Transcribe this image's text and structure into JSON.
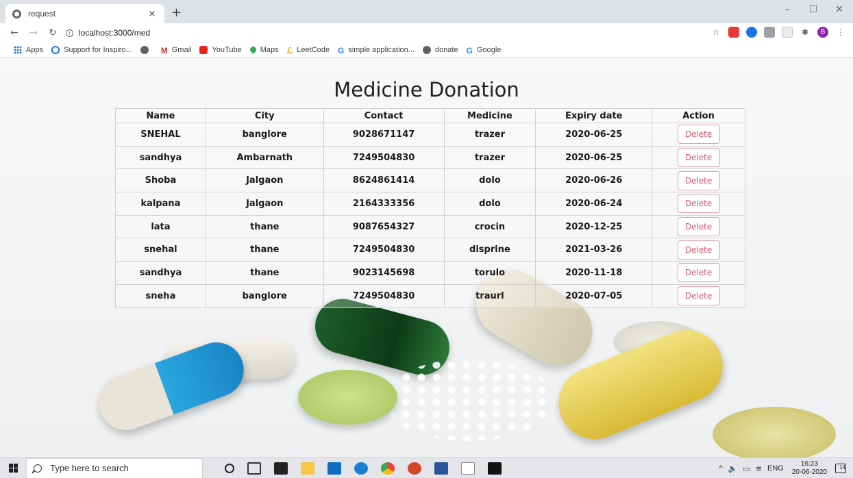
{
  "browser": {
    "tab_title": "request",
    "tab_close": "×",
    "new_tab": "+",
    "url": "localhost:3000/med",
    "window_controls": [
      "–",
      "☐",
      "✕"
    ],
    "bookmarks": [
      {
        "label": "Apps",
        "icon": "apps-icon"
      },
      {
        "label": "Support for Inspiro...",
        "icon": "support-icon"
      },
      {
        "label": "",
        "icon": "globe-icon"
      },
      {
        "label": "Gmail",
        "icon": "gmail-icon"
      },
      {
        "label": "YouTube",
        "icon": "youtube-icon"
      },
      {
        "label": "Maps",
        "icon": "maps-icon"
      },
      {
        "label": "LeetCode",
        "icon": "leetcode-icon"
      },
      {
        "label": "simple application...",
        "icon": "google-icon"
      },
      {
        "label": "donate",
        "icon": "globe-icon"
      },
      {
        "label": "Google",
        "icon": "google-icon"
      }
    ],
    "profile_initial": "B"
  },
  "page": {
    "title": "Medicine Donation",
    "table": {
      "headers": [
        "Name",
        "City",
        "Contact",
        "Medicine",
        "Expiry date",
        "Action"
      ],
      "rows": [
        {
          "name": "SNEHAL",
          "city": "banglore",
          "contact": "9028671147",
          "medicine": "trazer",
          "expiry": "2020-06-25",
          "action": "Delete"
        },
        {
          "name": "sandhya",
          "city": "Ambarnath",
          "contact": "7249504830",
          "medicine": "trazer",
          "expiry": "2020-06-25",
          "action": "Delete"
        },
        {
          "name": "Shoba",
          "city": "Jalgaon",
          "contact": "8624861414",
          "medicine": "dolo",
          "expiry": "2020-06-26",
          "action": "Delete"
        },
        {
          "name": "kalpana",
          "city": "Jalgaon",
          "contact": "2164333356",
          "medicine": "dolo",
          "expiry": "2020-06-24",
          "action": "Delete"
        },
        {
          "name": "lata",
          "city": "thane",
          "contact": "9087654327",
          "medicine": "crocin",
          "expiry": "2020-12-25",
          "action": "Delete"
        },
        {
          "name": "snehal",
          "city": "thane",
          "contact": "7249504830",
          "medicine": "disprine",
          "expiry": "2021-03-26",
          "action": "Delete"
        },
        {
          "name": "sandhya",
          "city": "thane",
          "contact": "9023145698",
          "medicine": "torulo",
          "expiry": "2020-11-18",
          "action": "Delete"
        },
        {
          "name": "sneha",
          "city": "banglore",
          "contact": "7249504830",
          "medicine": "traurl",
          "expiry": "2020-07-05",
          "action": "Delete"
        }
      ]
    }
  },
  "taskbar": {
    "search_placeholder": "Type here to search",
    "language": "ENG",
    "time": "16:23",
    "date": "20-06-2020",
    "notification_count": "14"
  }
}
